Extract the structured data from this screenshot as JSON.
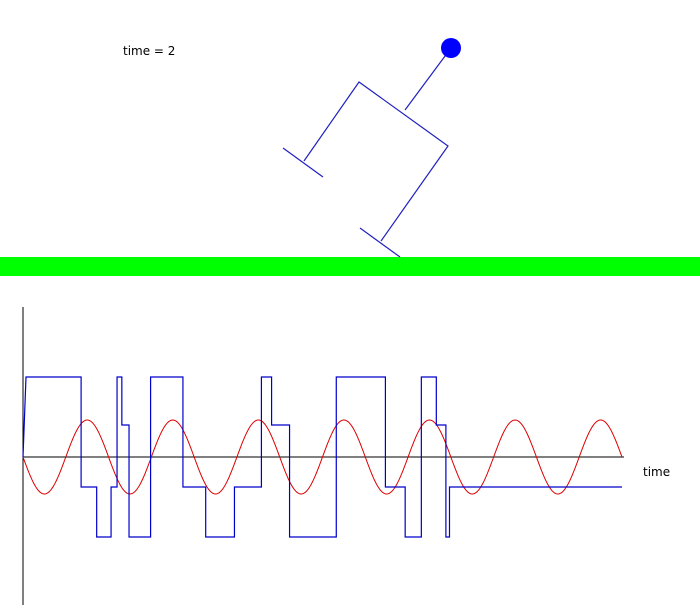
{
  "hud": {
    "time_prefix": "time = ",
    "time_value": "2",
    "time_text": "time = 2"
  },
  "plot": {
    "x_axis_label": "time"
  },
  "colors": {
    "background": "#ffffff",
    "ground": "#00ff00",
    "robot": "#2020c0",
    "robot_head": "#0000ff",
    "red_signal": "#dd0000",
    "blue_signal": "#0000cc",
    "axes": "#000000"
  },
  "chart_data": {
    "type": "line",
    "xlabel": "time",
    "series": [
      {
        "color": "#dd0000",
        "shape": "sine",
        "cycles": 7
      },
      {
        "color": "#0000cc",
        "shape": "bang-bang",
        "levels": [
          "high",
          "mid-high",
          "mid-low",
          "low"
        ],
        "steps": [
          [
            0.0,
            "high"
          ],
          [
            0.092,
            "mid-low"
          ],
          [
            0.118,
            "low"
          ],
          [
            0.142,
            "mid-low"
          ],
          [
            0.152,
            "high"
          ],
          [
            0.16,
            "mid-high"
          ],
          [
            0.172,
            "low"
          ],
          [
            0.208,
            "high"
          ],
          [
            0.262,
            "mid-low"
          ],
          [
            0.3,
            "low"
          ],
          [
            0.348,
            "mid-low"
          ],
          [
            0.393,
            "high"
          ],
          [
            0.41,
            "mid-high"
          ],
          [
            0.44,
            "low"
          ],
          [
            0.518,
            "high"
          ],
          [
            0.6,
            "mid-low"
          ],
          [
            0.633,
            "low"
          ],
          [
            0.66,
            "high"
          ],
          [
            0.685,
            "mid-high"
          ],
          [
            0.701,
            "low"
          ],
          [
            0.707,
            "mid-low"
          ]
        ]
      }
    ]
  }
}
